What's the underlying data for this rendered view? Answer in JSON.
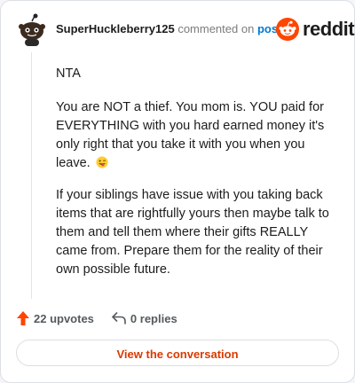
{
  "comment": {
    "username": "SuperHuckleberry125",
    "action_text": "commented on",
    "post_link": "post",
    "paragraphs": [
      "NTA",
      "You are NOT a thief. You mom is. YOU paid for EVERYTHING with you hard earned money it's only right that you take it with you when you leave.",
      "If your siblings have issue with you taking back items that are rightfully yours then maybe talk to them and tell them where their gifts REALLY came from. Prepare them for the reality of their own possible future."
    ],
    "emoji_icon": "winking-tongue-emoji"
  },
  "branding": {
    "wordmark": "reddit",
    "brand_color": "#ff4500"
  },
  "stats": {
    "upvotes": "22 upvotes",
    "replies": "0 replies"
  },
  "actions": {
    "view_conversation": "View the conversation"
  },
  "colors": {
    "upvote": "#ff4500",
    "link": "#0079d3",
    "button_text": "#d93a00"
  }
}
